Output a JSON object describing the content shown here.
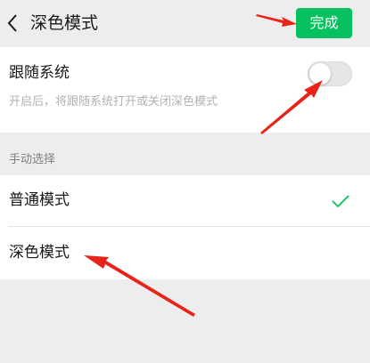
{
  "header": {
    "title": "深色模式",
    "done_label": "完成",
    "back_icon": "chevron-left-icon"
  },
  "follow_system": {
    "label": "跟随系统",
    "description": "开启后，将跟随系统打开或关闭深色模式",
    "enabled": false
  },
  "manual": {
    "section_label": "手动选择",
    "options": [
      {
        "label": "普通模式",
        "selected": true
      },
      {
        "label": "深色模式",
        "selected": false
      }
    ]
  },
  "colors": {
    "accent": "#07c160",
    "annotation": "#e8231a",
    "background": "#ededed"
  }
}
